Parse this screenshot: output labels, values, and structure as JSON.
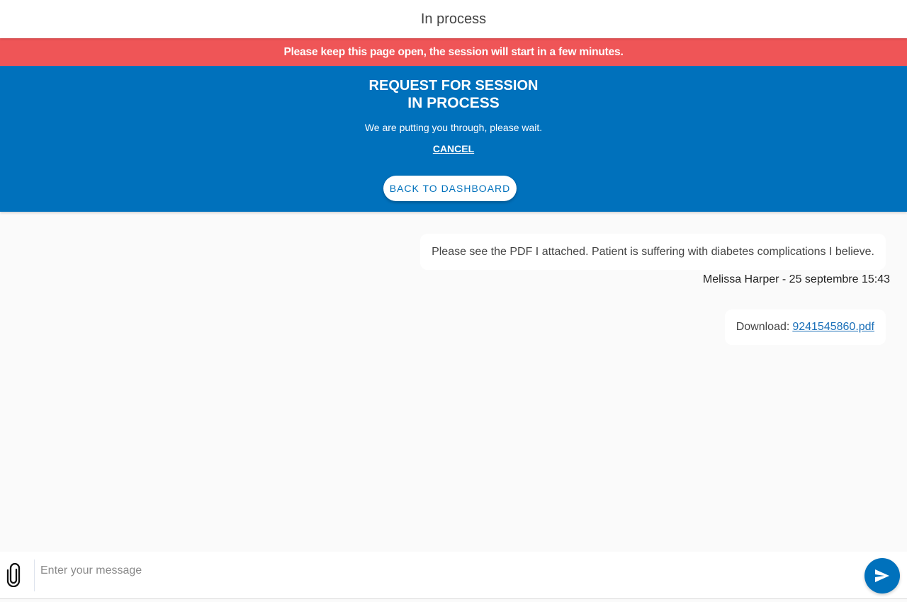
{
  "header": {
    "title": "In process"
  },
  "alert": {
    "text": "Please keep this page open, the session will start in a few minutes."
  },
  "status": {
    "heading_line1": "REQUEST FOR SESSION",
    "heading_line2": "IN PROCESS",
    "message": "We are putting you through, please wait.",
    "cancel_label": "CANCEL",
    "back_label": "BACK TO DASHBOARD"
  },
  "messages": [
    {
      "text": "Please see the PDF I attached. Patient is suffering with diabetes complications I believe.",
      "meta": "Melissa Harper - 25 septembre 15:43"
    },
    {
      "prefix": "Download:",
      "file_name": "9241545860.pdf"
    }
  ],
  "composer": {
    "placeholder": "Enter your message",
    "value": ""
  },
  "icons": {
    "attach": "paperclip-icon",
    "send": "send-icon"
  },
  "colors": {
    "primary": "#0071bc",
    "alert": "#ef5557",
    "background": "#fafafa"
  }
}
